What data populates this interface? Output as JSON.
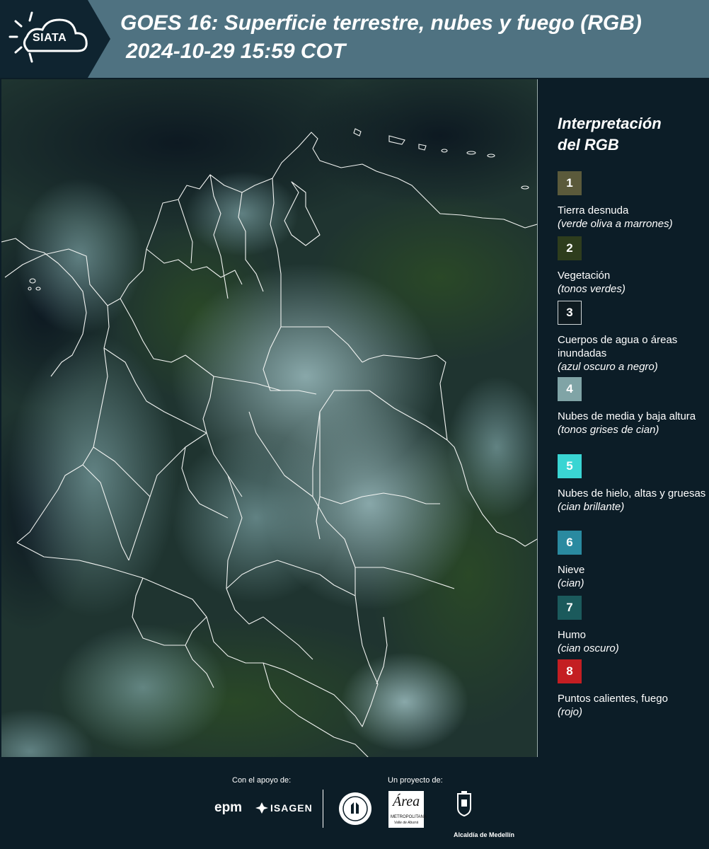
{
  "header": {
    "logo_text": "SIATA",
    "title": "GOES 16: Superficie terrestre, nubes y fuego (RGB)",
    "subtitle": "2024-10-29 15:59 COT",
    "background_color": "#4f7281"
  },
  "map": {
    "icon": "satellite-composite-map-colombia"
  },
  "legend": {
    "title_line1": "Interpretación",
    "title_line2": "del RGB",
    "items": [
      {
        "number": "1",
        "label": "Tierra desnuda",
        "desc": "(verde oliva a marrones)",
        "color": "#5b5a3b"
      },
      {
        "number": "2",
        "label": "Vegetación",
        "desc": "(tonos verdes)",
        "color": "#2e3d1d"
      },
      {
        "number": "3",
        "label": "Cuerpos de agua o áreas inundadas",
        "desc": "(azul oscuro a negro)",
        "color": "#0e1a20"
      },
      {
        "number": "4",
        "label": "Nubes de media y baja altura",
        "desc": "(tonos grises de cian)",
        "color": "#80a4a6"
      },
      {
        "number": "5",
        "label": "Nubes de hielo, altas y gruesas",
        "desc": "(cian brillante)",
        "color": "#3ad5d3"
      },
      {
        "number": "6",
        "label": "Nieve",
        "desc": "(cian)",
        "color": "#2a8aa0"
      },
      {
        "number": "7",
        "label": "Humo",
        "desc": "(cian oscuro)",
        "color": "#1b5a5c"
      },
      {
        "number": "8",
        "label": "Puntos calientes, fuego",
        "desc": "(rojo)",
        "color": "#c41e22"
      }
    ]
  },
  "footer": {
    "support_label": "Con el apoyo de:",
    "project_label": "Un proyecto de:",
    "epm": "epm",
    "isagen": "ISAGEN",
    "area_a": "Área",
    "area_m": "METROPOLITANA",
    "area_v": "Valle de Aburrá",
    "alcaldia": "Alcaldía de Medellín"
  }
}
